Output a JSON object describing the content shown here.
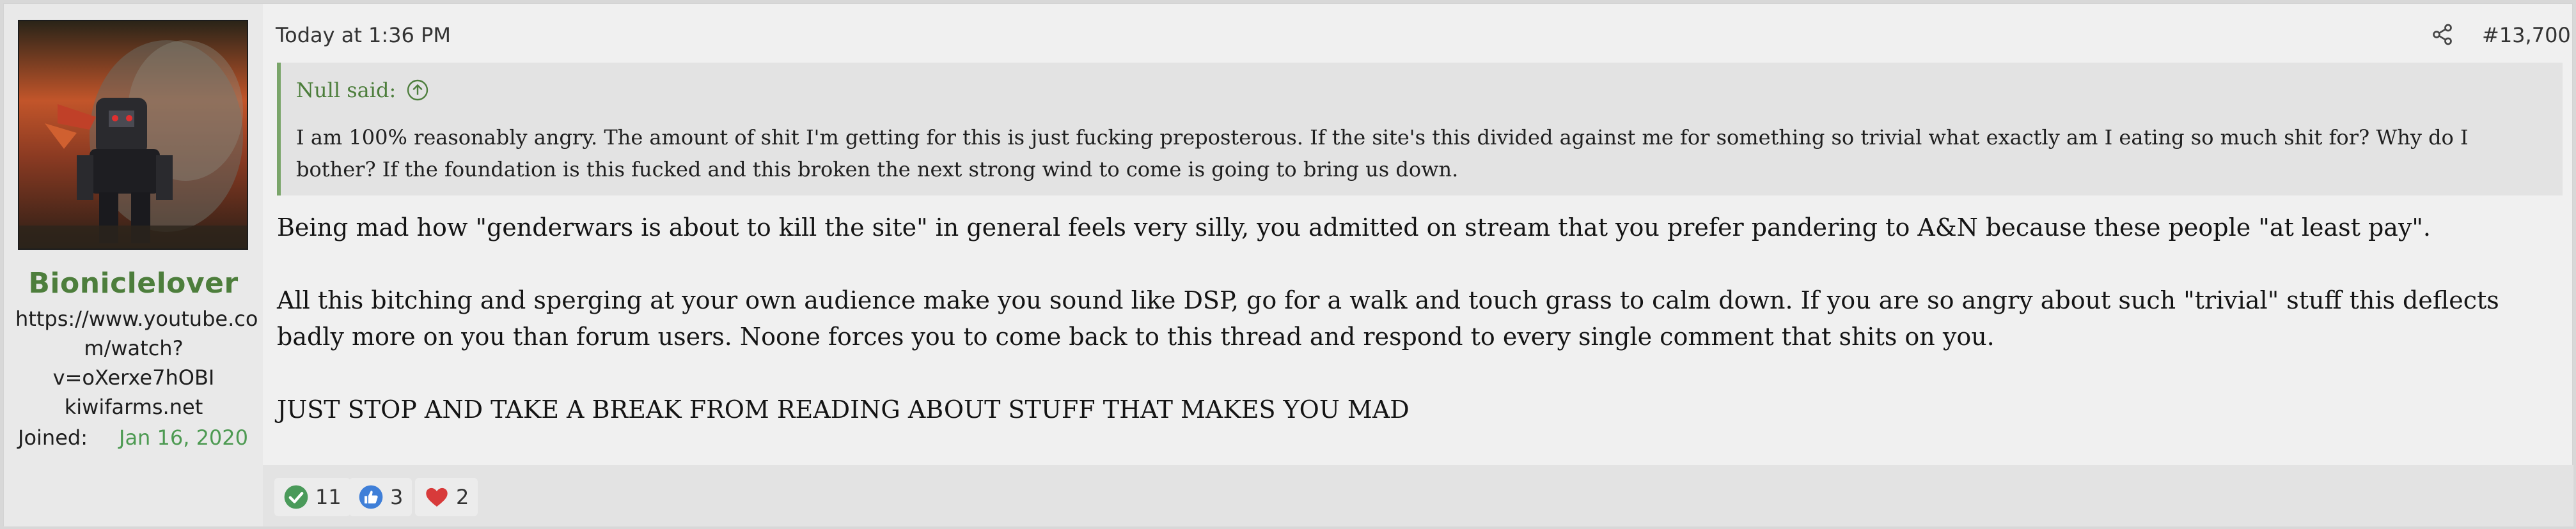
{
  "user": {
    "username": "Bioniclelover",
    "title": "https://www.youtube.co\nm/watch?\nv=oXerxe7hOBI\nkiwifarms.net",
    "joined_label": "Joined:",
    "joined_date": "Jan 16, 2020"
  },
  "post": {
    "timestamp": "Today at 1:36 PM",
    "number": "#13,700",
    "quote": {
      "author": "Null said:",
      "text": "I am 100% reasonably angry. The amount of shit I'm getting for this is just fucking preposterous. If the site's this divided against me for something so trivial what exactly am I eating so much shit for? Why do I bother? If the foundation is this fucked and this broken the next strong wind to come is going to bring us down."
    },
    "paragraphs": [
      "Being mad how \"genderwars is about to kill the site\" in general feels very silly, you admitted on stream that you prefer pandering to A&N because these people \"at least pay\".",
      "All this bitching and sperging at your own audience make you sound like DSP, go for a walk and touch grass to calm down. If you are so angry about such \"trivial\" stuff this deflects badly more on you than forum users. Noone forces you to come back to this thread and respond to every single comment that shits on you.",
      "JUST STOP AND TAKE A BREAK FROM READING ABOUT STUFF THAT MAKES YOU MAD"
    ]
  },
  "reactions": [
    {
      "icon": "check-icon",
      "count": "11",
      "color": "#4a9a5a"
    },
    {
      "icon": "thumbs-up-icon",
      "count": "3",
      "color": "#3f7fd8"
    },
    {
      "icon": "heart-icon",
      "count": "2",
      "color": "#d83a3a"
    }
  ],
  "colors": {
    "accent_green": "#4d7e3c",
    "joined_date": "#4d9a52",
    "quote_bar": "#7aa56a"
  }
}
